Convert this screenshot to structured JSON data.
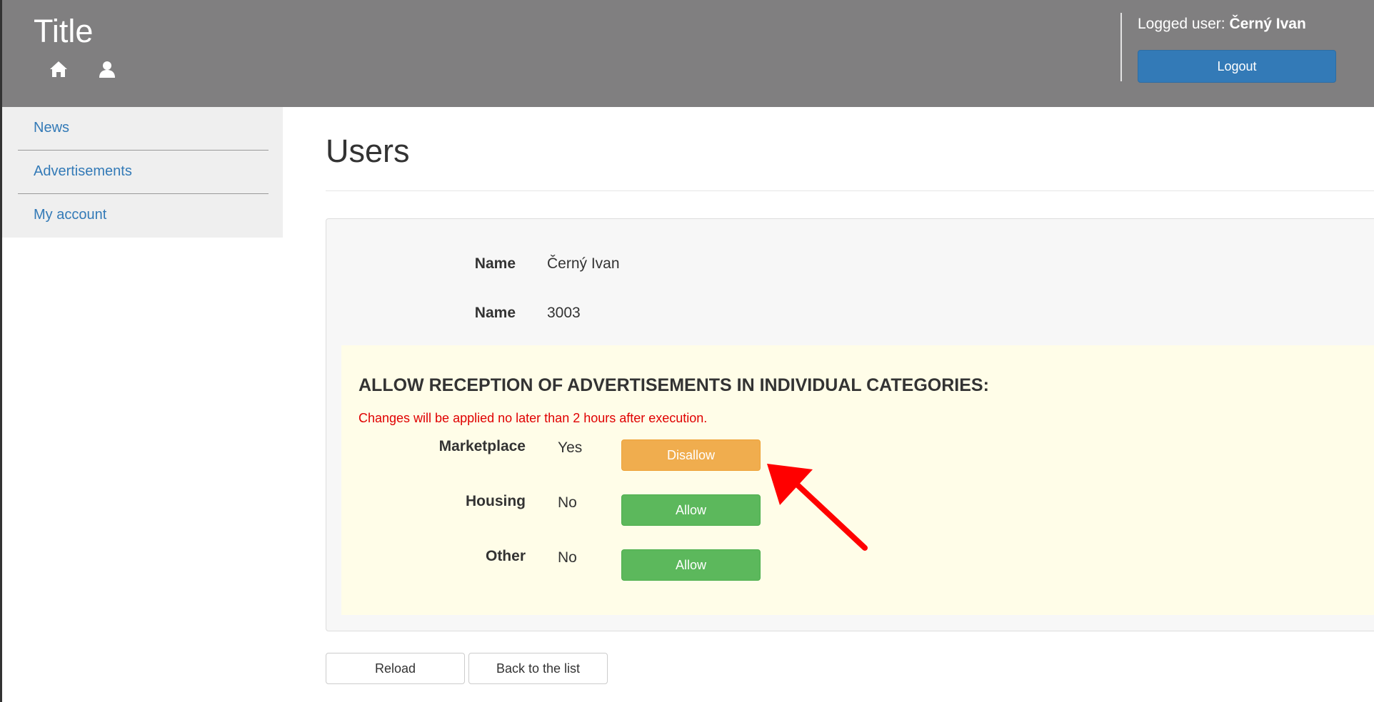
{
  "header": {
    "title": "Title",
    "home_icon": "home-icon",
    "user_icon": "user-icon",
    "logged_prefix": "Logged user: ",
    "logged_user": "Černý Ivan",
    "logout_label": "Logout"
  },
  "sidebar": {
    "items": [
      {
        "label": "News"
      },
      {
        "label": "Advertisements"
      },
      {
        "label": "My account"
      }
    ]
  },
  "main": {
    "page_title": "Users",
    "fields": [
      {
        "label": "Name",
        "value": "Černý Ivan"
      },
      {
        "label": "Name",
        "value": "3003"
      }
    ],
    "allow_section": {
      "heading": "ALLOW RECEPTION OF ADVERTISEMENTS IN INDIVIDUAL CATEGORIES:",
      "note": "Changes will be applied no later than 2 hours after execution.",
      "categories": [
        {
          "label": "Marketplace",
          "status": "Yes",
          "button": "Disallow"
        },
        {
          "label": "Housing",
          "status": "No",
          "button": "Allow"
        },
        {
          "label": "Other",
          "status": "No",
          "button": "Allow"
        }
      ]
    },
    "buttons": {
      "reload": "Reload",
      "back": "Back to the list"
    }
  },
  "colors": {
    "header_bg": "#807f80",
    "link": "#337ab7",
    "primary": "#337ab7",
    "warning": "#f0ad4e",
    "success": "#5cb85c",
    "note_red": "#e00000",
    "highlight_bg": "#fffde8",
    "annotation_arrow": "#ff0000"
  }
}
